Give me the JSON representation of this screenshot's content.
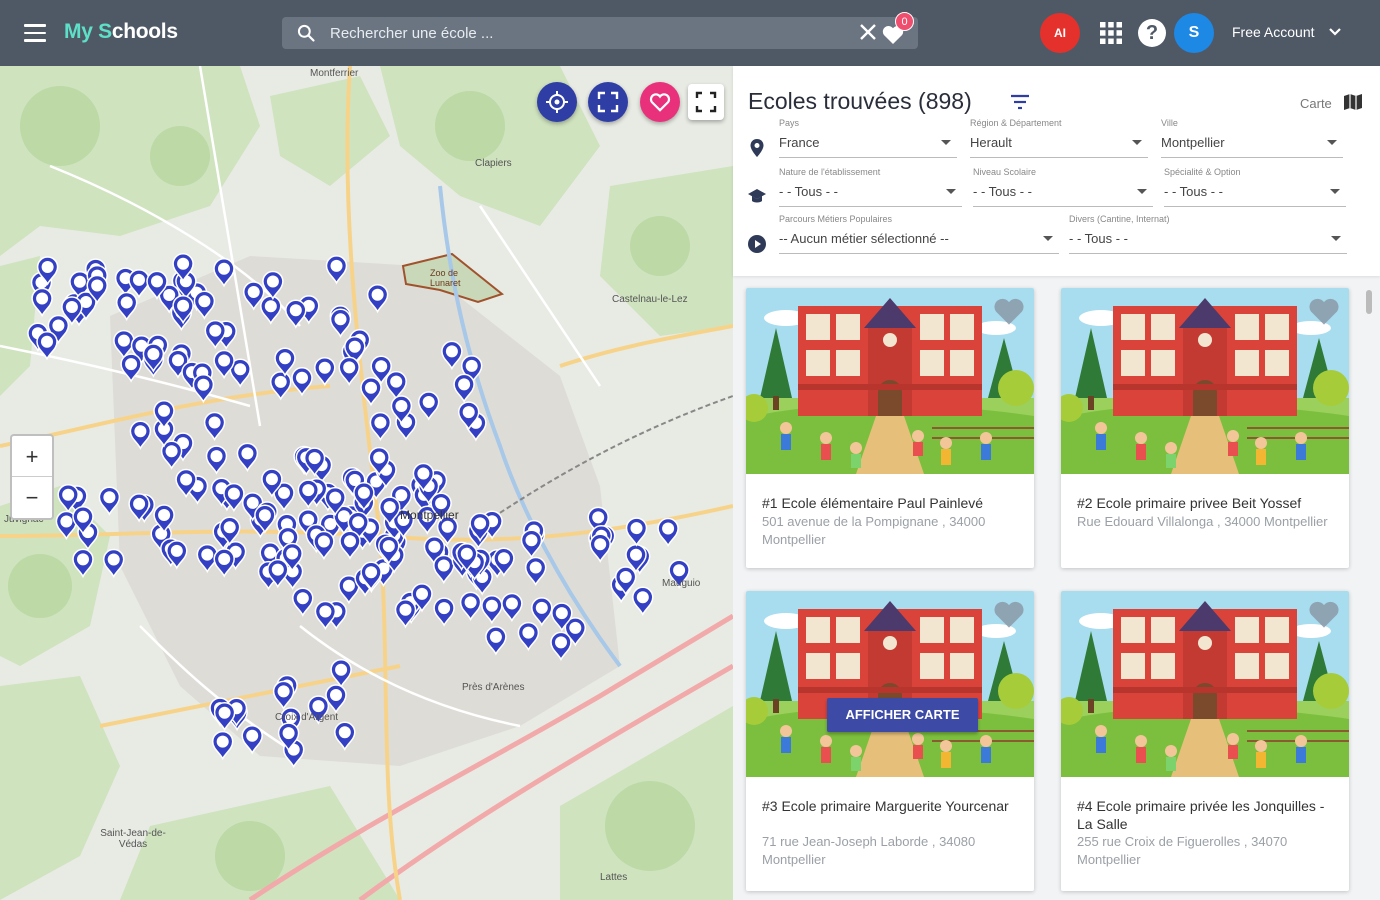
{
  "app": {
    "brand_my": "My",
    "brand_s": "S",
    "brand_rest": "chools"
  },
  "header": {
    "search_placeholder": "Rechercher une école ...",
    "favorites_count": "0",
    "ai_label": "AI",
    "user_initial": "S",
    "account_label": "Free Account"
  },
  "map": {
    "zoom_in": "+",
    "zoom_out": "−",
    "labels": [
      {
        "text": "Montferrier"
      },
      {
        "text": "Clapiers"
      },
      {
        "text": "Castelnau-le-Lez"
      },
      {
        "text": "Zoo de Lunaret"
      },
      {
        "text": "Juvignac"
      },
      {
        "text": "Montpellier"
      },
      {
        "text": "Lattes"
      },
      {
        "text": "Saint-Jean-de-Védas"
      },
      {
        "text": "Mauguio"
      },
      {
        "text": "Croix d'Argent"
      },
      {
        "text": "Près d'Arènes"
      }
    ],
    "marker_count": 230
  },
  "results": {
    "title": "Ecoles trouvées (898)",
    "map_toggle_label": "Carte",
    "filters": {
      "pays": {
        "label": "Pays",
        "value": "France"
      },
      "region": {
        "label": "Région & Département",
        "value": "Herault"
      },
      "ville": {
        "label": "Ville",
        "value": "Montpellier"
      },
      "nature": {
        "label": "Nature de l'établissement",
        "value": "- - Tous - -"
      },
      "niveau": {
        "label": "Niveau Scolaire",
        "value": "- - Tous - -"
      },
      "specialite": {
        "label": "Spécialité & Option",
        "value": "- - Tous - -"
      },
      "parcours": {
        "label": "Parcours Métiers Populaires",
        "value": "-- Aucun métier sélectionné --"
      },
      "divers": {
        "label": "Divers (Cantine, Internat)",
        "value": "- - Tous - -"
      }
    },
    "cards": [
      {
        "name": "#1 Ecole élémentaire Paul Painlevé",
        "address": "501 avenue de la Pompignane , 34000 Montpellier"
      },
      {
        "name": "#2 Ecole primaire privee Beit Yossef",
        "address": "Rue Edouard Villalonga , 34000 Montpellier"
      },
      {
        "name": "#3 Ecole primaire Marguerite Yourcenar",
        "address": "71 rue Jean-Joseph Laborde , 34080 Montpellier"
      },
      {
        "name": "#4 Ecole primaire privée les Jonquilles - La Salle",
        "address": "255 rue Croix de Figuerolles , 34070 Montpellier"
      }
    ],
    "show_on_map_button": "AFFICHER CARTE"
  },
  "colors": {
    "topbar": "#4f5966",
    "brand_accent": "#5ee0c8",
    "marker": "#3340c4",
    "fav_pink": "#e8307b",
    "ai_red": "#e5312b",
    "user_blue": "#1e88e5"
  }
}
